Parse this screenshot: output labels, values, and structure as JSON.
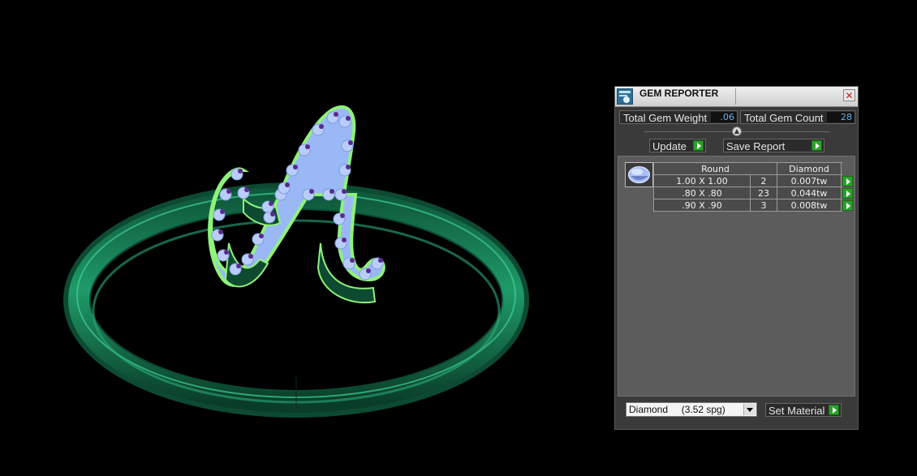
{
  "panel": {
    "title": "GEM REPORTER",
    "close_icon": "close-icon",
    "total_weight_label": "Total Gem Weight",
    "total_weight_value": ".06",
    "total_count_label": "Total Gem Count",
    "total_count_value": "28",
    "update_label": "Update",
    "save_label": "Save Report",
    "table": {
      "shape": "Round",
      "material": "Diamond",
      "rows": [
        {
          "size": "1.00 X 1.00",
          "count": "2",
          "weight": "0.007tw"
        },
        {
          "size": ".80 X .80",
          "count": "23",
          "weight": "0.044tw"
        },
        {
          "size": ".90 X .90",
          "count": "3",
          "weight": "0.008tw"
        }
      ]
    },
    "material_select": "Diamond     (3.52 spg)",
    "set_material_label": "Set Material"
  },
  "colors": {
    "ring": "#1e8a5e",
    "letter_fill": "#8ab0f0",
    "letter_edge": "#88f070",
    "prong": "#5a2a90"
  },
  "viewport": {
    "description_icon": "3d-ring-model"
  }
}
